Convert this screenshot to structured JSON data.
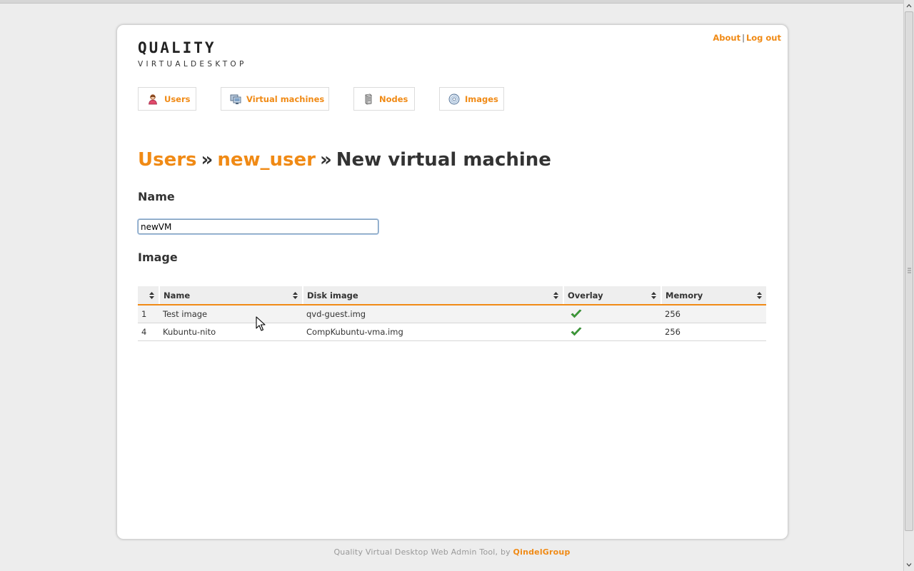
{
  "header": {
    "logo_text": "QUALITY",
    "logo_subtext": "VIRTUALDESKTOP",
    "links": [
      {
        "label": "About"
      },
      {
        "label": "Log out"
      }
    ],
    "link_separator": "|"
  },
  "nav": {
    "items": [
      {
        "label": "Users",
        "icon": "user-icon"
      },
      {
        "label": "Virtual machines",
        "icon": "virtual-machine-icon"
      },
      {
        "label": "Nodes",
        "icon": "server-icon"
      },
      {
        "label": "Images",
        "icon": "disc-icon"
      }
    ]
  },
  "breadcrumb": {
    "items": [
      "Users",
      "new_user"
    ],
    "current": "New virtual machine",
    "separator": "»"
  },
  "form": {
    "name_heading": "Name",
    "name_value": "newVM",
    "image_heading": "Image"
  },
  "table": {
    "columns": [
      "",
      "Name",
      "Disk image",
      "Overlay",
      "Memory"
    ],
    "rows": [
      {
        "id": "1",
        "name": "Test image",
        "disk_image": "qvd-guest.img",
        "overlay": true,
        "memory": "256"
      },
      {
        "id": "4",
        "name": "Kubuntu-nito",
        "disk_image": "CompKubuntu-vma.img",
        "overlay": true,
        "memory": "256"
      }
    ]
  },
  "footer": {
    "text": "Quality Virtual Desktop Web Admin Tool, by",
    "link": "QindelGroup"
  },
  "colors": {
    "accent": "#f08a15",
    "text": "#333333",
    "check": "#3fa13b"
  }
}
